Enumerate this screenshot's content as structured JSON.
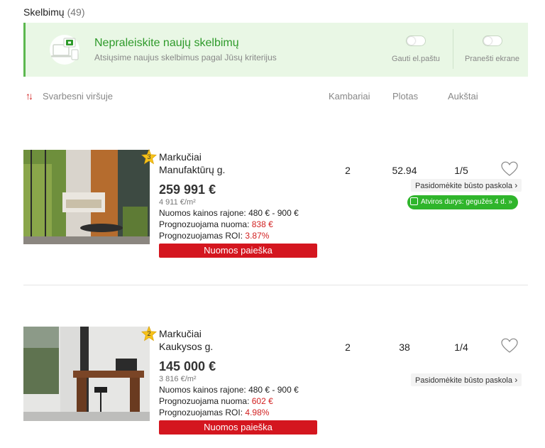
{
  "header": {
    "title": "Skelbimų",
    "count": "(49)"
  },
  "notify": {
    "title": "Nepraleiskite naujų skelbimų",
    "subtitle": "Atsiųsime naujus skelbimus pagal Jūsų kriterijus",
    "toggles": [
      {
        "label": "Gauti el.paštu",
        "on": false
      },
      {
        "label": "Pranešti ekrane",
        "on": false
      }
    ]
  },
  "sort": {
    "icon": "sort-arrows-icon",
    "label": "Svarbesni viršuje"
  },
  "columns": {
    "rooms": "Kambariai",
    "area": "Plotas",
    "floor": "Aukštai"
  },
  "listings": [
    {
      "rank": "3",
      "district": "Markučiai",
      "street": "Manufaktūrų g.",
      "price": "259 991 €",
      "price_per_sqm": "4 911 €/m²",
      "rent_range": "Nuomos kainos rajone: 480 € - 900 €",
      "forecast_rent_label": "Prognozuojama nuoma: ",
      "forecast_rent": "838 €",
      "forecast_roi_label": "Prognozuojamas ROI: ",
      "forecast_roi": "3.87%",
      "rent_search": "Nuomos paieška",
      "rooms": "2",
      "area": "52.94",
      "floor": "1/5",
      "loan": "Pasidomėkite būsto paskola",
      "open_doors": "Atviros durys:  gegužės 4 d. »"
    },
    {
      "rank": "2",
      "district": "Markučiai",
      "street": "Kaukysos g.",
      "price": "145 000 €",
      "price_per_sqm": "3 816 €/m²",
      "rent_range": "Nuomos kainos rajone: 480 € - 900 €",
      "forecast_rent_label": "Prognozuojama nuoma: ",
      "forecast_rent": "602 €",
      "forecast_roi_label": "Prognozuojamas ROI: ",
      "forecast_roi": "4.98%",
      "rent_search": "Nuomos paieška",
      "rooms": "2",
      "area": "38",
      "floor": "1/4",
      "loan": "Pasidomėkite būsto paskola"
    }
  ],
  "colors": {
    "accent_green": "#2e9a2a",
    "accent_red": "#d4161f",
    "open_green": "#2fb52b"
  }
}
